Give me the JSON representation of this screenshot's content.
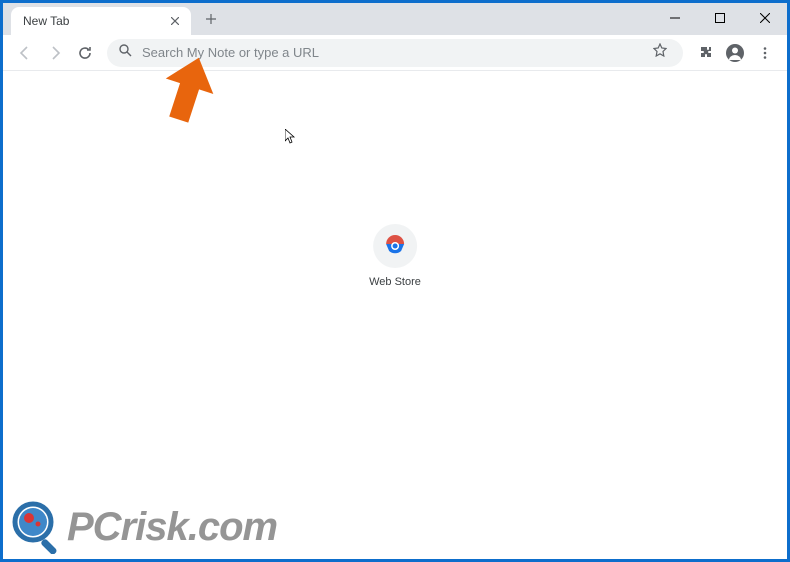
{
  "tab": {
    "title": "New Tab"
  },
  "omnibox": {
    "placeholder": "Search My Note or type a URL"
  },
  "shortcut": {
    "label": "Web Store"
  },
  "watermark": {
    "pc": "PC",
    "risk": "risk",
    "com": ".com"
  }
}
